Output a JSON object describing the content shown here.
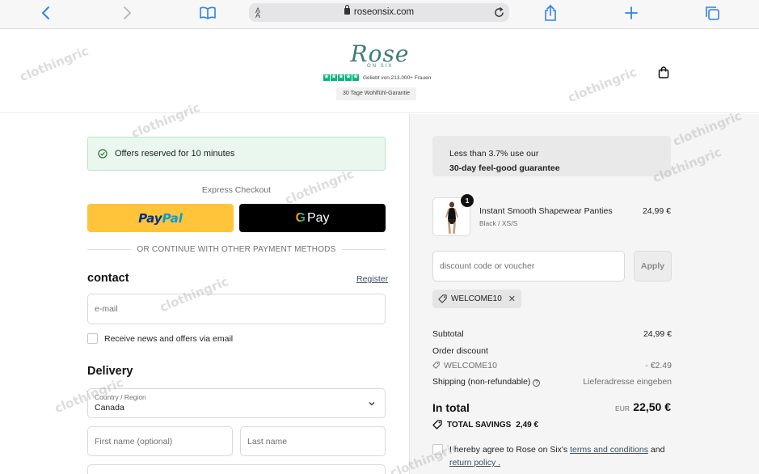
{
  "browser": {
    "url": "roseonsix.com",
    "aa_label": "A A",
    "icons": {
      "back": "chevron-left-icon",
      "forward": "chevron-right-icon",
      "bookmarks": "book-icon",
      "share": "share-icon",
      "new_tab": "plus-icon",
      "tabs": "tabs-icon",
      "reload": "reload-icon",
      "lock": "lock-icon"
    }
  },
  "header": {
    "logo_script": "Rose",
    "logo_sub": "ON SIX",
    "rating_text": "Geliebt von 213.000+ Frauen",
    "guarantee_pill": "30 Tage Wohlfühl-Garantie",
    "star_count": 5,
    "colors": {
      "brand": "#3e7d78",
      "trustpilot": "#00b67a"
    }
  },
  "checkout": {
    "notice": "Offers reserved for 10 minutes",
    "express_label": "Express Checkout",
    "paypal": {
      "part1": "Pay",
      "part2": "Pal"
    },
    "gpay": {
      "g": "G",
      "label": "Pay"
    },
    "divider_text": "OR CONTINUE WITH OTHER PAYMENT METHODS",
    "contact": {
      "heading": "contact",
      "register_link": "Register",
      "email_placeholder": "e-mail",
      "newsletter_label": "Receive news and offers via email",
      "newsletter_checked": false
    },
    "delivery": {
      "heading": "Delivery",
      "country_label": "Country / Region",
      "country_value": "Canada",
      "first_name_placeholder": "First name (optional)",
      "last_name_placeholder": "Last name"
    },
    "colors": {
      "notice_bg": "#e9f7ee",
      "paypal": "#ffc439",
      "link": "#3d4f61"
    }
  },
  "summary": {
    "guarantee_line1": "Less than 3.7% use our",
    "guarantee_line2": "30-day feel-good guarantee",
    "product": {
      "quantity": "1",
      "name": "Instant Smooth Shapewear Panties",
      "variant": "Black / XS/S",
      "price": "24,99 €"
    },
    "discount_placeholder": "discount code or voucher",
    "apply_label": "Apply",
    "applied_code": "WELCOME10",
    "subtotal_label": "Subtotal",
    "subtotal_value": "24,99 €",
    "order_discount_label": "Order discount",
    "discount_code": "WELCOME10",
    "discount_value": "- €2.49",
    "shipping_label": "Shipping (non-refundable)",
    "shipping_value": "Lieferadresse eingeben",
    "total_label": "In total",
    "total_currency": "EUR",
    "total_value": "22,50 €",
    "savings_label": "TOTAL SAVINGS",
    "savings_value": "2,49 €",
    "agree_prefix": "I hereby agree to Rose on Six's",
    "agree_terms": "terms and conditions",
    "agree_and": "and",
    "agree_return": "return policy .",
    "agree_checked": false
  },
  "watermark": "clothingric"
}
